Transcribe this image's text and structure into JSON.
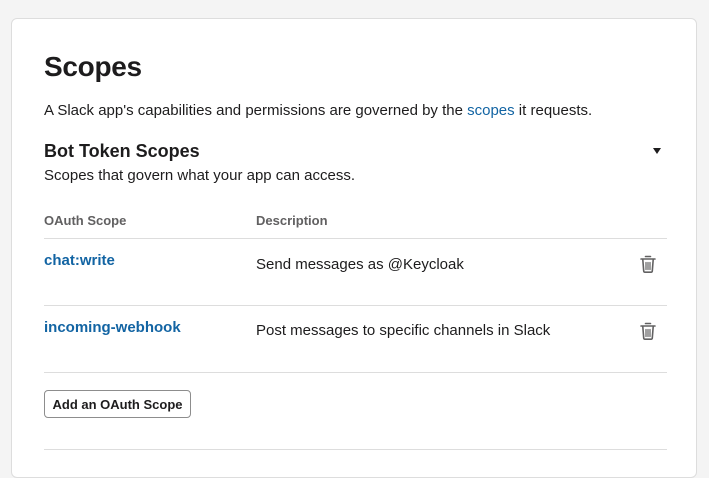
{
  "scopes_section": {
    "title": "Scopes",
    "intro_before": "A Slack app's capabilities and permissions are governed by the ",
    "intro_link": "scopes",
    "intro_after": " it requests."
  },
  "bot_token_scopes": {
    "title": "Bot Token Scopes",
    "subtitle": "Scopes that govern what your app can access.",
    "collapse_icon": "caret-down-icon",
    "table": {
      "columns": [
        "OAuth Scope",
        "Description"
      ],
      "rows": [
        {
          "scope": "chat:write",
          "description": "Send messages as @Keycloak",
          "action_icon": "trash-icon"
        },
        {
          "scope": "incoming-webhook",
          "description": "Post messages to specific channels in Slack",
          "action_icon": "trash-icon"
        }
      ]
    },
    "add_button_label": "Add an OAuth Scope"
  },
  "colors": {
    "link": "#1264a3",
    "text": "#1d1c1d",
    "muted": "#616061",
    "divider": "#dddddd",
    "page_bg": "#f4f4f4"
  }
}
